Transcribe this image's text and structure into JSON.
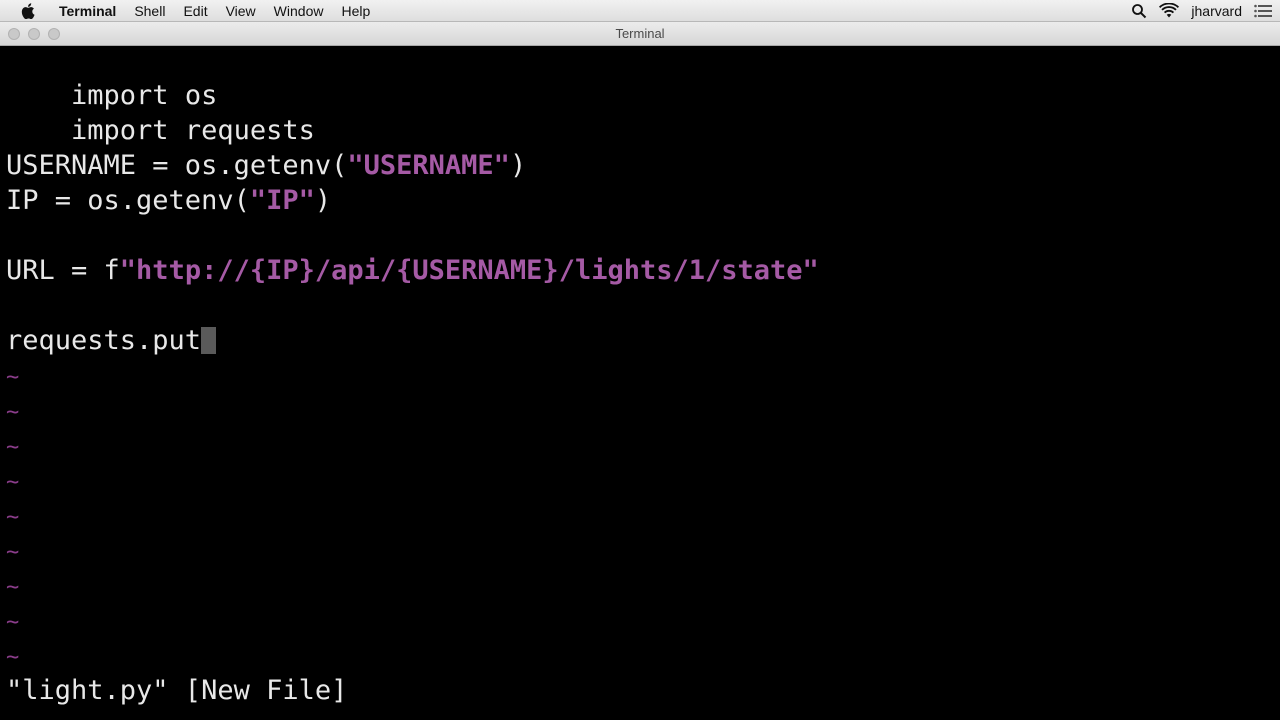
{
  "menubar": {
    "app_name": "Terminal",
    "items": [
      "Shell",
      "Edit",
      "View",
      "Window",
      "Help"
    ],
    "user": "jharvard"
  },
  "window": {
    "title": "Terminal"
  },
  "editor": {
    "lines": {
      "l1": "import os",
      "l2": "import requests",
      "l4_a": "USERNAME = os.getenv(",
      "l4_b": "\"USERNAME\"",
      "l4_c": ")",
      "l5_a": "IP = os.getenv(",
      "l5_b": "\"IP\"",
      "l5_c": ")",
      "l7_a": "URL = f",
      "l7_b": "\"http://{IP}/api/{USERNAME}/lights/1/state\"",
      "l9": "requests.put"
    },
    "empty_line_marker": "~",
    "status_line": "\"light.py\" [New File]"
  },
  "colors": {
    "string": "#a55aa5",
    "tilde": "#8b3d8b",
    "background": "#000000",
    "text": "#e8e8e8"
  }
}
